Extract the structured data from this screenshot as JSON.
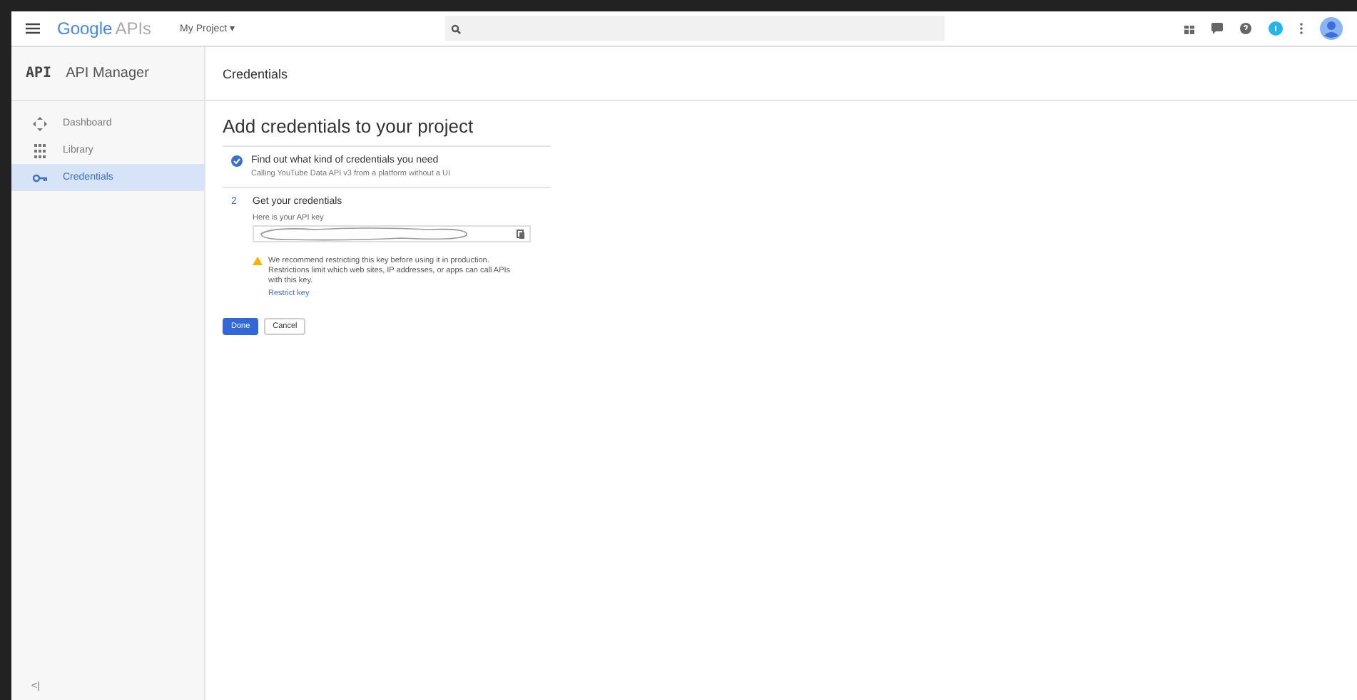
{
  "topbar": {
    "logo_brand": "Google",
    "logo_suffix": "APIs",
    "project": "My Project",
    "project_caret": "▾"
  },
  "sidebar": {
    "badge": "API",
    "title": "API Manager",
    "items": [
      {
        "label": "Dashboard",
        "kind": "dashboard",
        "selected": false
      },
      {
        "label": "Library",
        "kind": "library",
        "selected": false
      },
      {
        "label": "Credentials",
        "kind": "key",
        "selected": true
      }
    ],
    "collapse": "<|"
  },
  "page_title": "Credentials",
  "heading": "Add credentials to your project",
  "steps": [
    {
      "kind": "done",
      "title": "Find out what kind of credentials you need",
      "subtitle": "Calling YouTube Data API v3 from a platform without a UI"
    },
    {
      "kind": "current",
      "number": "2",
      "title": "Get your credentials",
      "key_label": "Here is your API key",
      "warning": "We recommend restricting this key before using it in production. Restrictions limit which web sites, IP addresses, or apps can call APIs with this key.",
      "link": "Restrict key"
    }
  ],
  "buttons": [
    {
      "label": "Done",
      "kind": "primary"
    },
    {
      "label": "Cancel",
      "kind": "secondary"
    }
  ]
}
